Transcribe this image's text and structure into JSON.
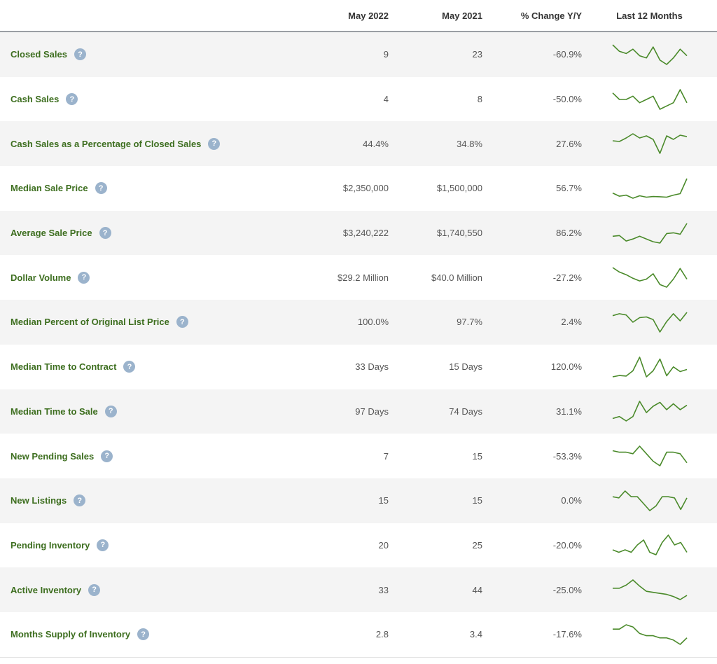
{
  "headers": {
    "metric": "",
    "col1": "May 2022",
    "col2": "May 2021",
    "col3": "% Change Y/Y",
    "col4": "Last 12 Months"
  },
  "colors": {
    "label": "#3d6e1f",
    "spark": "#4a8a2a",
    "help": "#9bb3cc"
  },
  "help_icon_glyph": "?",
  "rows": [
    {
      "label": "Closed Sales",
      "v2022": "9",
      "v2021": "23",
      "change": "-60.9%",
      "trend": [
        19,
        16,
        15,
        17,
        14,
        13,
        18,
        12,
        10,
        13,
        17,
        14
      ]
    },
    {
      "label": "Cash Sales",
      "v2022": "4",
      "v2021": "8",
      "change": "-50.0%",
      "trend": [
        9,
        7,
        7,
        8,
        6,
        7,
        8,
        4,
        5,
        6,
        10,
        6
      ]
    },
    {
      "label": "Cash Sales as a Percentage of Closed Sales",
      "v2022": "44.4%",
      "v2021": "34.8%",
      "change": "27.6%",
      "trend": [
        38,
        37,
        42,
        48,
        42,
        45,
        40,
        20,
        45,
        40,
        46,
        44
      ]
    },
    {
      "label": "Median Sale Price",
      "v2022": "$2,350,000",
      "v2021": "$1,500,000",
      "change": "56.7%",
      "trend": [
        1.65,
        1.5,
        1.55,
        1.4,
        1.52,
        1.45,
        1.48,
        1.47,
        1.45,
        1.55,
        1.62,
        2.35
      ]
    },
    {
      "label": "Average Sale Price",
      "v2022": "$3,240,222",
      "v2021": "$1,740,550",
      "change": "86.2%",
      "trend": [
        2.3,
        2.35,
        1.95,
        2.1,
        2.3,
        2.1,
        1.9,
        1.8,
        2.5,
        2.55,
        2.45,
        3.24
      ]
    },
    {
      "label": "Dollar Volume",
      "v2022": "$29.2 Million",
      "v2021": "$40.0 Million",
      "change": "-27.2%",
      "trend": [
        42,
        37,
        34,
        30,
        27,
        29,
        35,
        23,
        20,
        29,
        41,
        29
      ]
    },
    {
      "label": "Median Percent of Original List Price",
      "v2022": "100.0%",
      "v2021": "97.7%",
      "change": "2.4%",
      "trend": [
        99.5,
        99.8,
        99.6,
        98.5,
        99.2,
        99.3,
        98.9,
        97.0,
        98.6,
        99.8,
        98.7,
        100.0
      ]
    },
    {
      "label": "Median Time to Contract",
      "v2022": "33 Days",
      "v2021": "15 Days",
      "change": "120.0%",
      "trend": [
        10,
        15,
        13,
        33,
        85,
        10,
        33,
        78,
        14,
        48,
        30,
        38
      ]
    },
    {
      "label": "Median Time to Sale",
      "v2022": "97 Days",
      "v2021": "74 Days",
      "change": "31.1%",
      "trend": [
        70,
        74,
        65,
        74,
        105,
        82,
        95,
        103,
        88,
        100,
        88,
        97
      ]
    },
    {
      "label": "New Pending Sales",
      "v2022": "7",
      "v2021": "15",
      "change": "-53.3%",
      "trend": [
        15,
        14,
        14,
        13,
        18,
        13,
        8,
        5,
        14,
        14,
        13,
        7
      ]
    },
    {
      "label": "New Listings",
      "v2022": "15",
      "v2021": "15",
      "change": "0.0%",
      "trend": [
        16,
        15,
        21,
        16,
        16,
        10,
        4,
        8,
        16,
        16,
        15,
        5,
        15
      ]
    },
    {
      "label": "Pending Inventory",
      "v2022": "20",
      "v2021": "25",
      "change": "-20.0%",
      "trend": [
        23,
        22,
        23,
        22,
        25,
        27,
        22,
        21,
        26,
        29,
        25,
        26,
        22
      ]
    },
    {
      "label": "Active Inventory",
      "v2022": "33",
      "v2021": "44",
      "change": "-25.0%",
      "trend": [
        44,
        44,
        47,
        52,
        46,
        41,
        40,
        39,
        38,
        36,
        33,
        37
      ]
    },
    {
      "label": "Months Supply of Inventory",
      "v2022": "2.8",
      "v2021": "3.4",
      "change": "-17.6%",
      "trend": [
        3.4,
        3.4,
        3.6,
        3.5,
        3.2,
        3.1,
        3.1,
        3.0,
        3.0,
        2.9,
        2.7,
        3.0
      ]
    }
  ]
}
